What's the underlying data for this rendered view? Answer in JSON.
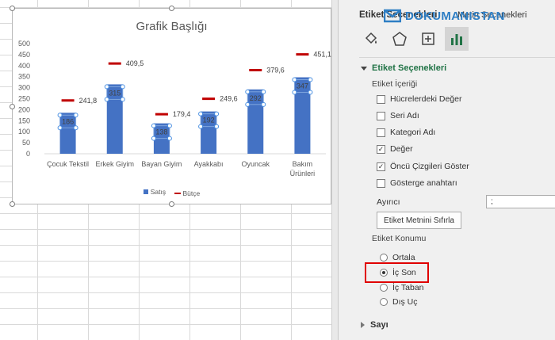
{
  "chart_data": {
    "type": "bar",
    "title": "Grafik Başlığı",
    "categories": [
      "Çocuk Tekstil",
      "Erkek Giyim",
      "Bayan Giyim",
      "Ayakkabı",
      "Oyuncak",
      "Bakım Ürünleri"
    ],
    "category_lines": [
      [
        "Çocuk Tekstil"
      ],
      [
        "Erkek Giyim"
      ],
      [
        "Bayan Giyim"
      ],
      [
        "Ayakkabı"
      ],
      [
        "Oyuncak"
      ],
      [
        "Bakım",
        "Ürünleri"
      ]
    ],
    "series": [
      {
        "name": "Satış",
        "type": "bar",
        "color": "#4472c4",
        "values": [
          186,
          315,
          138,
          192,
          292,
          347
        ]
      },
      {
        "name": "Bütçe",
        "type": "marker",
        "color": "#c00000",
        "values": [
          241.8,
          409.5,
          179.4,
          249.6,
          379.6,
          451.1
        ]
      }
    ],
    "data_labels_bar": [
      "186",
      "315",
      "138",
      "192",
      "292",
      "347"
    ],
    "data_labels_budget": [
      "241,8",
      "409,5",
      "179,4",
      "249,6",
      "379,6",
      "451,1"
    ],
    "ylim": [
      0,
      500
    ],
    "yticks": [
      "0",
      "50",
      "100",
      "150",
      "200",
      "250",
      "300",
      "350",
      "400",
      "450",
      "500"
    ],
    "ytick_values": [
      0,
      50,
      100,
      150,
      200,
      250,
      300,
      350,
      400,
      450,
      500
    ],
    "grid": false,
    "legend_position": "bottom",
    "xlabel": "",
    "ylabel": ""
  },
  "legend": {
    "bar_label": "Satış",
    "line_label": "Bütçe"
  },
  "pane": {
    "title": "Etiket Seçenekleri",
    "subtitle": "Metin Seçenekleri",
    "tabs": [
      {
        "name": "fill-icon",
        "active": false
      },
      {
        "name": "effects-icon",
        "active": false
      },
      {
        "name": "size-icon",
        "active": false
      },
      {
        "name": "chart-options-icon",
        "active": true
      }
    ],
    "section_title": "Etiket Seçenekleri",
    "content_group_label": "Etiket İçeriği",
    "content_options": [
      {
        "label": "Hücrelerdeki Değer",
        "checked": false
      },
      {
        "label": "Seri Adı",
        "checked": false
      },
      {
        "label": "Kategori Adı",
        "checked": false
      },
      {
        "label": "Değer",
        "checked": true
      },
      {
        "label": "Öncü Çizgileri Göster",
        "checked": true
      },
      {
        "label": "Gösterge anahtarı",
        "checked": false
      }
    ],
    "separator_label": "Ayırıcı",
    "separator_value": ";",
    "reset_button": "Etiket Metnini Sıfırla",
    "position_group_label": "Etiket Konumu",
    "position_options": [
      {
        "label": "Ortala",
        "selected": false
      },
      {
        "label": "İç Son",
        "selected": true
      },
      {
        "label": "İç Taban",
        "selected": false
      },
      {
        "label": "Dış Uç",
        "selected": false
      }
    ],
    "collapsed_section": "Sayı"
  },
  "watermark": {
    "text": "DOKUMANISTAN"
  },
  "colors": {
    "accent_green": "#217346",
    "bar_blue": "#4472c4",
    "budget_red": "#c00000",
    "highlight_red": "#e00000"
  }
}
